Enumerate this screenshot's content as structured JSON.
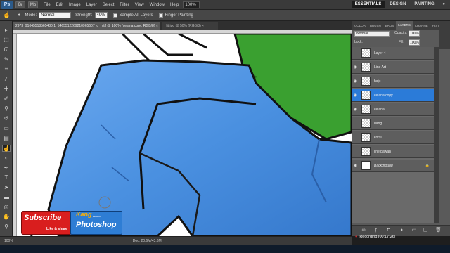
{
  "app": {
    "logo": "Ps",
    "menus": [
      "File",
      "Edit",
      "Image",
      "Layer",
      "Select",
      "Filter",
      "View",
      "Window",
      "Help"
    ],
    "zoom": "100%",
    "workspaces": [
      "ESSENTIALS",
      "DESIGN",
      "PAINTING"
    ],
    "workspace_more": "»"
  },
  "options": {
    "mode_label": "Mode:",
    "mode_value": "Normal",
    "strength_label": "Strength:",
    "strength_value": "49%",
    "sample_all_layers": "Sample All Layers",
    "finger_painting": "Finger Painting"
  },
  "tabs": [
    {
      "label": "2973_91045518565480 1_5465512269210965607_o_n.tif @ 100% (celana copy, RGB/8) ×",
      "active": true
    },
    {
      "label": "Hit.jpg @ 50% (RGB/8) ×",
      "active": false
    }
  ],
  "tools": [
    {
      "icon": "move-icon",
      "glyph": "▸"
    },
    {
      "icon": "marquee-icon",
      "glyph": "⬚"
    },
    {
      "icon": "lasso-icon",
      "glyph": "ᘏ"
    },
    {
      "icon": "quick-select-icon",
      "glyph": "✎"
    },
    {
      "icon": "crop-icon",
      "glyph": "⌗"
    },
    {
      "icon": "eyedropper-icon",
      "glyph": "⁄"
    },
    {
      "icon": "healing-icon",
      "glyph": "✚"
    },
    {
      "icon": "brush-icon",
      "glyph": "✐"
    },
    {
      "icon": "stamp-icon",
      "glyph": "⚲"
    },
    {
      "icon": "history-brush-icon",
      "glyph": "↺"
    },
    {
      "icon": "eraser-icon",
      "glyph": "▭"
    },
    {
      "icon": "gradient-icon",
      "glyph": "▤"
    },
    {
      "icon": "smudge-icon",
      "glyph": "☝"
    },
    {
      "icon": "dodge-icon",
      "glyph": "◐"
    },
    {
      "icon": "pen-icon",
      "glyph": "✒"
    },
    {
      "icon": "type-icon",
      "glyph": "T"
    },
    {
      "icon": "path-select-icon",
      "glyph": "➤"
    },
    {
      "icon": "shape-icon",
      "glyph": "▬"
    },
    {
      "icon": "3d-rotate-icon",
      "glyph": "◎"
    },
    {
      "icon": "hand-icon",
      "glyph": "✋"
    },
    {
      "icon": "zoom-icon",
      "glyph": "⚲"
    }
  ],
  "active_tool": 12,
  "status": {
    "zoom": "100%",
    "doc": "Doc: 20.6M/43.6M"
  },
  "panel": {
    "tabs": [
      "COLOR",
      "BRUSH",
      "BRUS",
      "LAYERS",
      "CHANNE",
      "HISTO"
    ],
    "active_tab": 3,
    "blend_mode": "Normal",
    "opacity_label": "Opacity:",
    "opacity_value": "100%",
    "lock_label": "Lock:",
    "fill_label": "Fill:",
    "fill_value": "100%",
    "layers": [
      {
        "name": "Layer 4",
        "visible": false,
        "selected": false,
        "italic": false
      },
      {
        "name": "Line Art",
        "visible": true,
        "selected": false,
        "italic": false
      },
      {
        "name": "baju",
        "visible": true,
        "selected": false,
        "italic": false
      },
      {
        "name": "celana copy",
        "visible": true,
        "selected": true,
        "italic": false
      },
      {
        "name": "celana",
        "visible": true,
        "selected": false,
        "italic": false
      },
      {
        "name": "uang",
        "visible": false,
        "selected": false,
        "italic": false
      },
      {
        "name": "korsi",
        "visible": false,
        "selected": false,
        "italic": false
      },
      {
        "name": "line bawah",
        "visible": false,
        "selected": false,
        "italic": false
      },
      {
        "name": "Background",
        "visible": true,
        "selected": false,
        "italic": true
      }
    ]
  },
  "recording": "Recording [00:17:26]",
  "overlay": {
    "subscribe": "Subscribe",
    "like_share": "Like & share",
    "kang": "Kang",
    "adobe": "Adobe",
    "photoshop": "Photoshop"
  },
  "colors": {
    "pants": "#4a90e0",
    "shirt": "#3aa030",
    "selected_layer": "#2b7bd8",
    "subscribe": "#d91e1e"
  }
}
